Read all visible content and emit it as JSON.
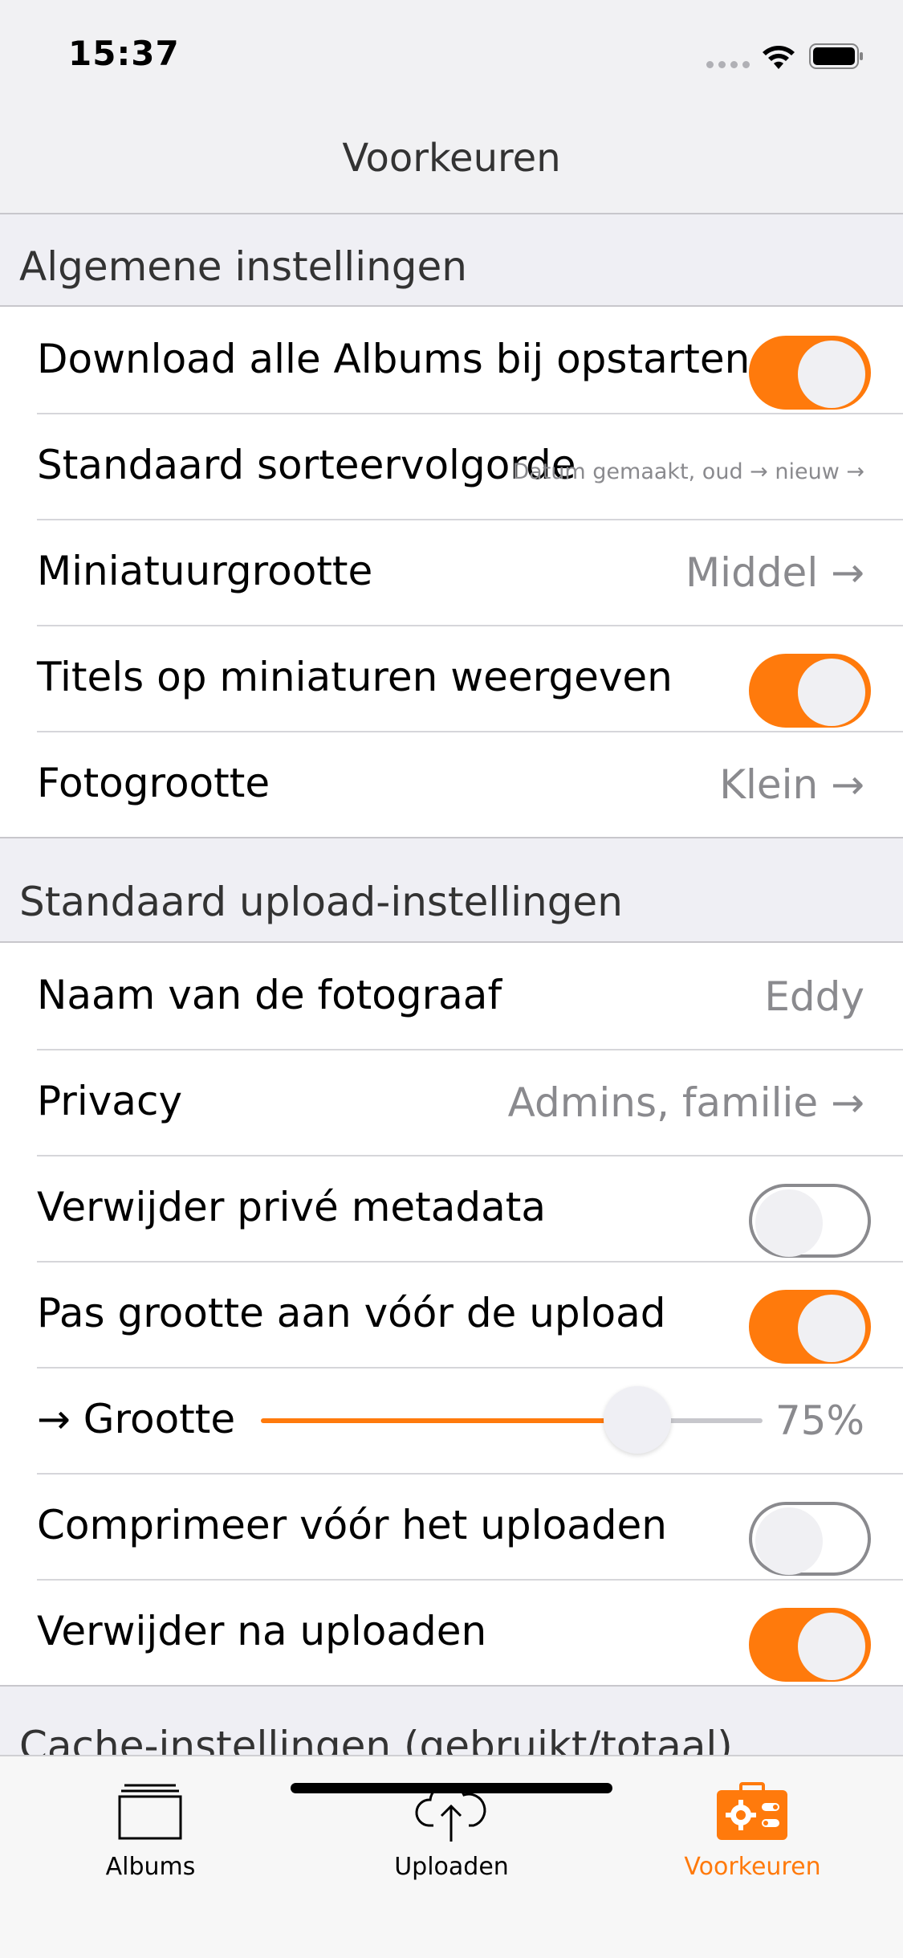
{
  "status_bar": {
    "time": "15:37"
  },
  "nav": {
    "title": "Voorkeuren"
  },
  "sections": {
    "general": {
      "header": "Algemene instellingen",
      "rows": [
        {
          "label": "Download alle Albums bij opstarten",
          "toggle": true
        },
        {
          "label": "Standaard sorteervolgorde",
          "value": "Datum gemaakt, oud → nieuw →"
        },
        {
          "label": "Miniatuurgrootte",
          "value": "Middel →"
        },
        {
          "label": "Titels op miniaturen weergeven",
          "toggle": true
        },
        {
          "label": "Fotogrootte",
          "value": "Klein →"
        }
      ]
    },
    "upload": {
      "header": "Standaard upload-instellingen",
      "rows": [
        {
          "label": "Naam van de fotograaf",
          "value": "Eddy"
        },
        {
          "label": "Privacy",
          "value": "Admins, familie →"
        },
        {
          "label": "Verwijder privé metadata",
          "toggle": false
        },
        {
          "label": "Pas grootte aan vóór de upload",
          "toggle": true
        },
        {
          "label": "→ Grootte",
          "value": "75%",
          "slider_fraction": 0.75
        },
        {
          "label": "Comprimeer vóór het uploaden",
          "toggle": false
        },
        {
          "label": "Verwijder na uploaden",
          "toggle": true
        }
      ]
    },
    "cache": {
      "header": "Cache-instellingen (gebruikt/totaal)"
    }
  },
  "tab_bar": {
    "tabs": [
      {
        "label": "Albums",
        "icon": "albums-icon",
        "active": false
      },
      {
        "label": "Uploaden",
        "icon": "cloud-upload-icon",
        "active": false
      },
      {
        "label": "Voorkeuren",
        "icon": "settings-toolbox-icon",
        "active": true
      }
    ]
  },
  "colors": {
    "accent": "#ff7a0c",
    "background": "#efeff4",
    "secondary_text": "#8a8a8e"
  }
}
